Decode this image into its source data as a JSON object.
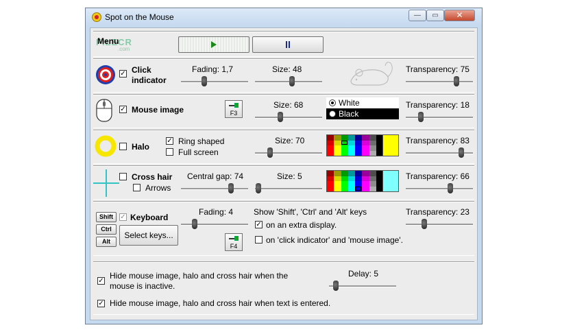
{
  "window": {
    "title": "Spot on the Mouse",
    "minimize": "—",
    "maximize": "▭",
    "close": "✕"
  },
  "menu": {
    "label": "Menu",
    "watermark": "FILECR",
    "watermark_sub": ".com"
  },
  "playback": {
    "play_icon": "play-icon",
    "pause_icon": "pause-icon"
  },
  "click_indicator": {
    "label_line1": "Click",
    "label_line2": "indicator",
    "checked": true,
    "fading_label": "Fading: 1,7",
    "fading_pos": 0.35,
    "size_label": "Size: 48",
    "size_pos": 0.55,
    "transparency_label": "Transparency: 75",
    "transparency_pos": 0.75
  },
  "mouse_image": {
    "label": "Mouse image",
    "checked": true,
    "hotkey": "F3",
    "size_label": "Size: 68",
    "size_pos": 0.38,
    "white_label": "White",
    "black_label": "Black",
    "selected": "White",
    "transparency_label": "Transparency: 18",
    "transparency_pos": 0.22
  },
  "halo": {
    "label": "Halo",
    "checked": false,
    "ring_shaped_label": "Ring shaped",
    "ring_shaped": true,
    "full_screen_label": "Full screen",
    "full_screen": false,
    "size_label": "Size: 70",
    "size_pos": 0.22,
    "color": "#ffff00",
    "transparency_label": "Transparency: 83",
    "transparency_pos": 0.83
  },
  "cross_hair": {
    "label": "Cross hair",
    "checked": false,
    "arrows_label": "Arrows",
    "arrows": false,
    "gap_label": "Central gap: 74",
    "gap_pos": 0.74,
    "size_label": "Size: 5",
    "size_pos": 0.05,
    "color": "#80ffff",
    "transparency_label": "Transparency: 66",
    "transparency_pos": 0.66
  },
  "keyboard": {
    "label": "Keyboard",
    "checked": true,
    "shift": "Shift",
    "ctrl": "Ctrl",
    "alt": "Alt",
    "select_keys": "Select keys...",
    "hotkey": "F4",
    "fading_label": "Fading: 4",
    "fading_pos": 0.2,
    "show_keys_label": "Show 'Shift', 'Ctrl' and 'Alt' keys",
    "extra_display_label": "on an extra display.",
    "extra_display": true,
    "click_indicator_label": "on 'click indicator' and 'mouse image'.",
    "click_indicator_opt": false,
    "transparency_label": "Transparency: 23",
    "transparency_pos": 0.28
  },
  "options": {
    "hide_inactive_line1": "Hide mouse image, halo and cross hair when the",
    "hide_inactive_line2": "mouse is inactive.",
    "hide_inactive": true,
    "delay_label": "Delay: 5",
    "delay_pos": 0.1,
    "hide_text_label": "Hide mouse image, halo and cross hair when text is entered.",
    "hide_text": true
  }
}
